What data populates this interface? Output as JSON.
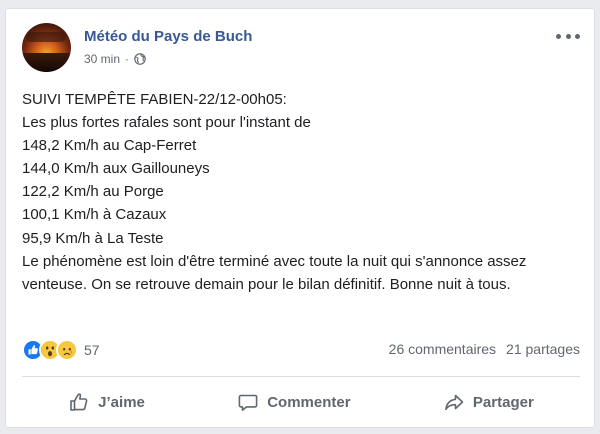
{
  "post": {
    "page_name": "Météo du Pays de Buch",
    "time": "30 min",
    "separator": "·",
    "audience_icon": "globe-icon",
    "options_icon": "more-options-icon",
    "lines": [
      "SUIVI TEMPÊTE FABIEN-22/12-00h05:",
      "Les plus fortes rafales sont pour l'instant de",
      "148,2 Km/h au Cap-Ferret",
      "144,0 Km/h aux Gaillouneys",
      "122,2 Km/h au Porge",
      "100,1 Km/h à Cazaux",
      "95,9 Km/h à La Teste"
    ],
    "paragraph": "Le phénomène est loin d'être terminé avec toute la nuit qui s'annonce assez venteuse. On se retrouve demain pour le bilan définitif. Bonne nuit à tous."
  },
  "stats": {
    "reaction_icons": [
      "like-icon",
      "wow-icon",
      "sad-icon"
    ],
    "reaction_count": "57",
    "comments": "26 commentaires",
    "shares": "21 partages"
  },
  "actions": {
    "like_label": "J’aime",
    "comment_label": "Commenter",
    "share_label": "Partager"
  },
  "colors": {
    "link_blue": "#385898",
    "like_blue": "#1877f2",
    "reaction_yellow": "#f7c740",
    "text_gray": "#606770"
  }
}
